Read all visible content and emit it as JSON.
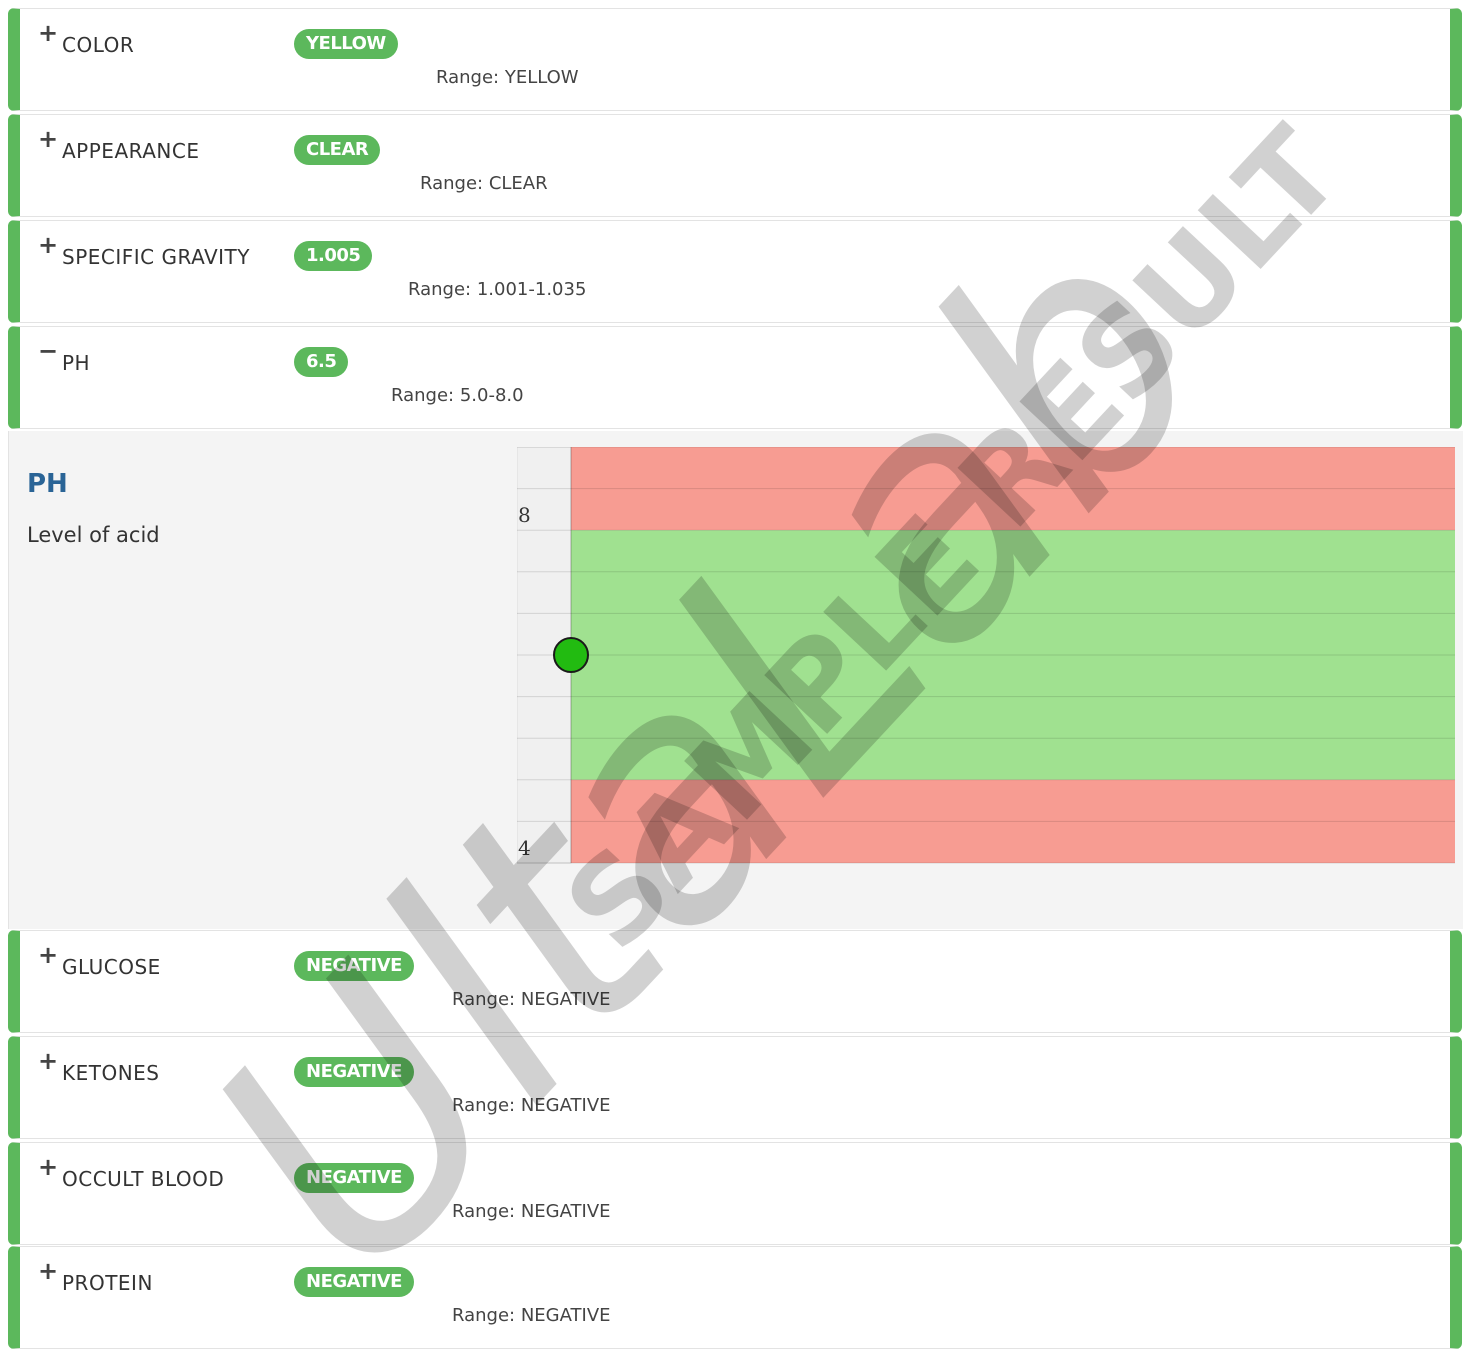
{
  "rows_top": [
    {
      "toggle": "+",
      "name": "COLOR",
      "value": "YELLOW",
      "range": "Range: YELLOW"
    },
    {
      "toggle": "+",
      "name": "APPEARANCE",
      "value": "CLEAR",
      "range": "Range: CLEAR"
    },
    {
      "toggle": "+",
      "name": "SPECIFIC GRAVITY",
      "value": "1.005",
      "range": "Range: 1.001-1.035"
    },
    {
      "toggle": "−",
      "name": "PH",
      "value": "6.5",
      "range": "Range: 5.0-8.0"
    }
  ],
  "detail": {
    "title": "PH",
    "description": "Level of acid"
  },
  "rows_bottom": [
    {
      "toggle": "+",
      "name": "GLUCOSE",
      "value": "NEGATIVE",
      "range": "Range: NEGATIVE"
    },
    {
      "toggle": "+",
      "name": "KETONES",
      "value": "NEGATIVE",
      "range": "Range: NEGATIVE"
    },
    {
      "toggle": "+",
      "name": "OCCULT BLOOD",
      "value": "NEGATIVE",
      "range": "Range: NEGATIVE"
    },
    {
      "toggle": "+",
      "name": "PROTEIN",
      "value": "NEGATIVE",
      "range": "Range: NEGATIVE"
    }
  ],
  "watermark": {
    "logo": "UltaLab",
    "stamp": "SAMPLE RESULT"
  },
  "colors": {
    "accent": "#5cb85c",
    "title": "#2a6496",
    "normal_band": "#a0e190",
    "abnormal_band": "#f79c92",
    "marker": "#22bb11"
  },
  "chart_data": {
    "type": "range_band",
    "ylim": [
      4,
      9
    ],
    "tick_labels": [
      "8",
      "4"
    ],
    "tick_values": [
      8,
      4
    ],
    "normal_range": [
      5.0,
      8.0
    ],
    "value": 6.5
  }
}
